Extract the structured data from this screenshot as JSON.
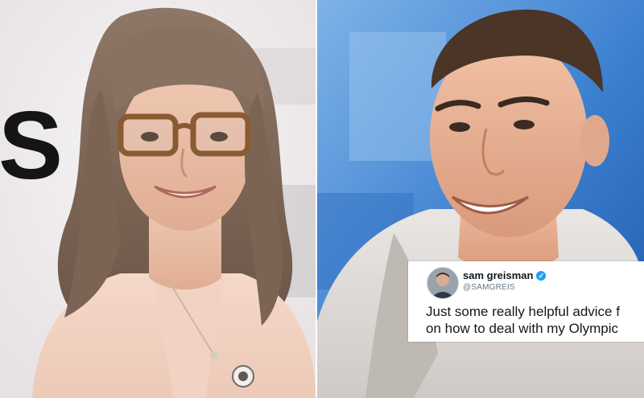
{
  "tweet": {
    "display_name": "sam greisman",
    "verified_icon": "verified-badge-icon",
    "handle": "@SAMGREIS",
    "text_line_1": "Just some really helpful advice f",
    "text_line_2": "on how to deal with my Olympic"
  },
  "colors": {
    "verified_blue": "#1da1f2",
    "left_backdrop": "#f1eeef",
    "right_backdrop": "#3b7fd0"
  },
  "backdrop_lettering": "S"
}
